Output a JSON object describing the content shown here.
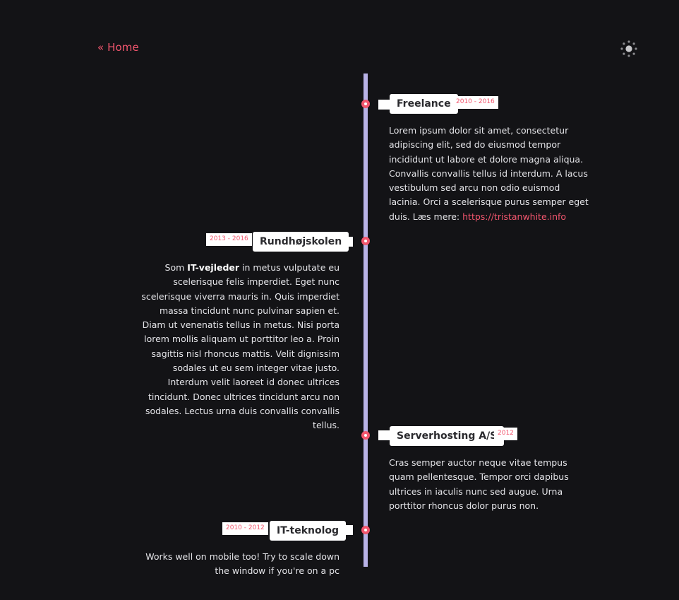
{
  "nav": {
    "home_label": "« Home"
  },
  "theme": {
    "icon": "sun-icon"
  },
  "colors": {
    "background": "#131316",
    "accent": "#f2566e",
    "timeline_line": "#b8b2e6",
    "card": "#ffffff"
  },
  "timeline": [
    {
      "side": "right",
      "title": "Freelance",
      "dates": "2010 - 2016",
      "description_text": "Lorem ipsum dolor sit amet, consectetur adipiscing elit, sed do eiusmod tempor incididunt ut labore et dolore magna aliqua. Convallis convallis tellus id interdum. A lacus vestibulum sed arcu non odio euismod lacinia. Orci a scelerisque purus semper eget duis. Læs mere: ",
      "link_text": "https://tristanwhite.info"
    },
    {
      "side": "left",
      "title": "Rundhøjskolen",
      "dates": "2013 - 2016",
      "description_prefix": "Som ",
      "description_bold": "IT-vejleder",
      "description_text": " in metus vulputate eu scelerisque felis imperdiet. Eget nunc scelerisque viverra mauris in. Quis imperdiet massa tincidunt nunc pulvinar sapien et. Diam ut venenatis tellus in metus. Nisi porta lorem mollis aliquam ut porttitor leo a. Proin sagittis nisl rhoncus mattis. Velit dignissim sodales ut eu sem integer vitae justo. Interdum velit laoreet id donec ultrices tincidunt. Donec ultrices tincidunt arcu non sodales. Lectus urna duis convallis convallis tellus."
    },
    {
      "side": "right",
      "title": "Serverhosting A/S",
      "dates": "2012",
      "description_text": "Cras semper auctor neque vitae tempus quam pellentesque. Tempor orci dapibus ultrices in iaculis nunc sed augue. Urna porttitor rhoncus dolor purus non."
    },
    {
      "side": "left",
      "title": "IT-teknolog",
      "dates": "2010 - 2012",
      "description_text": "Works well on mobile too! Try to scale down the window if you're on a pc"
    }
  ]
}
